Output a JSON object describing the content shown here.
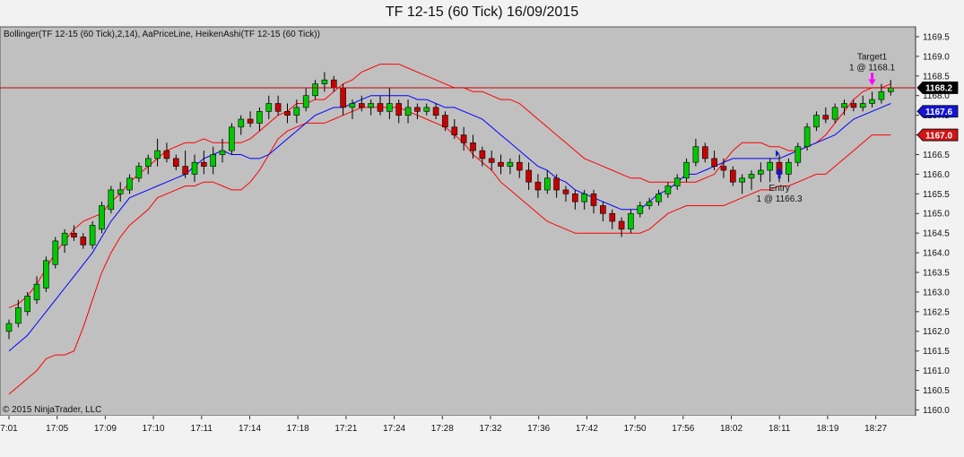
{
  "title": "TF 12-15 (60 Tick)  16/09/2015",
  "indicators": "Bollinger(TF 12-15 (60 Tick),2,14), AaPriceLine, HeikenAshi(TF 12-15 (60 Tick))",
  "copyright": "© 2015 NinjaTrader, LLC",
  "chart_data": {
    "type": "candlestick",
    "ylim": [
      1159.85,
      1169.75
    ],
    "y_ticks": [
      "1160.0",
      "1160.5",
      "1161.0",
      "1161.5",
      "1162.0",
      "1162.5",
      "1163.0",
      "1163.5",
      "1164.0",
      "1164.5",
      "1165.0",
      "1165.5",
      "1166.0",
      "1166.5",
      "1167.0",
      "1167.5",
      "1168.0",
      "1168.5",
      "1169.0",
      "1169.5"
    ],
    "x_ticks": [
      "7:01",
      "17:05",
      "17:09",
      "17:10",
      "17:11",
      "17:14",
      "17:18",
      "17:21",
      "17:24",
      "17:28",
      "17:32",
      "17:36",
      "17:42",
      "17:50",
      "17:56",
      "18:02",
      "18:11",
      "18:19",
      "18:27"
    ],
    "price_line": 1168.2,
    "price_tags": [
      {
        "label": "1168.2",
        "value": 1168.2,
        "bg": "#000000",
        "fg": "#ffffff"
      },
      {
        "label": "1167.6",
        "value": 1167.6,
        "bg": "#1414d2",
        "fg": "#ffffff"
      },
      {
        "label": "1167.0",
        "value": 1167.0,
        "bg": "#d21414",
        "fg": "#ffffff"
      }
    ],
    "bollinger": {
      "upper": [
        1162.6,
        1162.7,
        1162.9,
        1163.2,
        1163.6,
        1164.0,
        1164.3,
        1164.6,
        1164.8,
        1164.9,
        1165.0,
        1165.3,
        1165.5,
        1165.8,
        1166.0,
        1166.2,
        1166.4,
        1166.6,
        1166.7,
        1166.8,
        1166.8,
        1166.9,
        1166.8,
        1166.8,
        1166.8,
        1166.8,
        1166.9,
        1167.1,
        1167.3,
        1167.5,
        1167.6,
        1167.8,
        1167.8,
        1167.9,
        1167.9,
        1168.1,
        1168.3,
        1168.4,
        1168.6,
        1168.7,
        1168.8,
        1168.8,
        1168.8,
        1168.7,
        1168.6,
        1168.5,
        1168.4,
        1168.3,
        1168.2,
        1168.2,
        1168.1,
        1168.1,
        1168.0,
        1167.9,
        1167.9,
        1167.8,
        1167.6,
        1167.4,
        1167.2,
        1167.0,
        1166.8,
        1166.6,
        1166.4,
        1166.3,
        1166.2,
        1166.1,
        1166.0,
        1165.9,
        1165.9,
        1165.8,
        1165.8,
        1165.8,
        1165.8,
        1165.8,
        1165.8,
        1165.9,
        1166.0,
        1166.3,
        1166.6,
        1166.8,
        1166.8,
        1166.8,
        1166.7,
        1166.7,
        1166.6,
        1166.6,
        1166.7,
        1166.8,
        1167.0,
        1167.3,
        1167.6,
        1167.9,
        1168.1,
        1168.2,
        1168.2,
        1168.3
      ],
      "middle": [
        1161.5,
        1161.7,
        1161.9,
        1162.2,
        1162.5,
        1162.8,
        1163.1,
        1163.4,
        1163.7,
        1164.0,
        1164.4,
        1164.8,
        1165.1,
        1165.4,
        1165.5,
        1165.6,
        1165.7,
        1165.8,
        1165.9,
        1166.0,
        1166.2,
        1166.4,
        1166.5,
        1166.6,
        1166.5,
        1166.5,
        1166.4,
        1166.4,
        1166.5,
        1166.7,
        1166.9,
        1167.1,
        1167.3,
        1167.5,
        1167.6,
        1167.7,
        1167.7,
        1167.8,
        1167.9,
        1168.0,
        1168.0,
        1168.0,
        1168.0,
        1168.0,
        1167.9,
        1167.9,
        1167.8,
        1167.7,
        1167.7,
        1167.6,
        1167.5,
        1167.4,
        1167.2,
        1167.0,
        1166.8,
        1166.6,
        1166.4,
        1166.2,
        1166.1,
        1165.9,
        1165.8,
        1165.6,
        1165.5,
        1165.4,
        1165.3,
        1165.2,
        1165.1,
        1165.1,
        1165.1,
        1165.3,
        1165.5,
        1165.6,
        1165.8,
        1166.0,
        1166.0,
        1166.1,
        1166.2,
        1166.3,
        1166.4,
        1166.4,
        1166.4,
        1166.4,
        1166.4,
        1166.4,
        1166.5,
        1166.6,
        1166.7,
        1166.8,
        1166.9,
        1167.0,
        1167.2,
        1167.4,
        1167.5,
        1167.6,
        1167.7,
        1167.8
      ],
      "lower": [
        1160.4,
        1160.6,
        1160.8,
        1161.0,
        1161.3,
        1161.4,
        1161.4,
        1161.5,
        1162.1,
        1162.8,
        1163.5,
        1164.0,
        1164.4,
        1164.7,
        1164.9,
        1165.1,
        1165.4,
        1165.5,
        1165.6,
        1165.7,
        1165.7,
        1165.8,
        1165.8,
        1165.7,
        1165.6,
        1165.6,
        1165.8,
        1166.1,
        1166.5,
        1166.9,
        1167.1,
        1167.2,
        1167.3,
        1167.3,
        1167.3,
        1167.4,
        1167.5,
        1167.6,
        1167.7,
        1167.7,
        1167.7,
        1167.7,
        1167.7,
        1167.6,
        1167.5,
        1167.4,
        1167.3,
        1167.2,
        1167.0,
        1166.8,
        1166.5,
        1166.3,
        1166.1,
        1165.8,
        1165.6,
        1165.4,
        1165.2,
        1165.0,
        1164.8,
        1164.7,
        1164.6,
        1164.5,
        1164.5,
        1164.5,
        1164.5,
        1164.5,
        1164.5,
        1164.5,
        1164.5,
        1164.6,
        1164.8,
        1165.0,
        1165.1,
        1165.2,
        1165.2,
        1165.2,
        1165.2,
        1165.2,
        1165.3,
        1165.4,
        1165.5,
        1165.6,
        1165.6,
        1165.7,
        1165.7,
        1165.8,
        1165.9,
        1166.0,
        1166.0,
        1166.2,
        1166.4,
        1166.6,
        1166.8,
        1167.0,
        1167.0,
        1167.0
      ]
    },
    "candles": [
      {
        "o": 1162.0,
        "h": 1162.3,
        "l": 1161.8,
        "c": 1162.2
      },
      {
        "o": 1162.2,
        "h": 1162.8,
        "l": 1162.1,
        "c": 1162.6
      },
      {
        "o": 1162.5,
        "h": 1163.0,
        "l": 1162.4,
        "c": 1162.9
      },
      {
        "o": 1162.8,
        "h": 1163.4,
        "l": 1162.7,
        "c": 1163.2
      },
      {
        "o": 1163.1,
        "h": 1163.9,
        "l": 1163.0,
        "c": 1163.8
      },
      {
        "o": 1163.7,
        "h": 1164.4,
        "l": 1163.6,
        "c": 1164.3
      },
      {
        "o": 1164.2,
        "h": 1164.6,
        "l": 1164.0,
        "c": 1164.5
      },
      {
        "o": 1164.5,
        "h": 1164.7,
        "l": 1164.3,
        "c": 1164.4
      },
      {
        "o": 1164.4,
        "h": 1164.5,
        "l": 1164.1,
        "c": 1164.2
      },
      {
        "o": 1164.2,
        "h": 1164.8,
        "l": 1164.1,
        "c": 1164.7
      },
      {
        "o": 1164.6,
        "h": 1165.3,
        "l": 1164.5,
        "c": 1165.2
      },
      {
        "o": 1165.1,
        "h": 1165.7,
        "l": 1165.0,
        "c": 1165.6
      },
      {
        "o": 1165.5,
        "h": 1165.8,
        "l": 1165.3,
        "c": 1165.6
      },
      {
        "o": 1165.6,
        "h": 1166.0,
        "l": 1165.5,
        "c": 1165.9
      },
      {
        "o": 1165.9,
        "h": 1166.3,
        "l": 1165.8,
        "c": 1166.2
      },
      {
        "o": 1166.2,
        "h": 1166.5,
        "l": 1166.0,
        "c": 1166.4
      },
      {
        "o": 1166.4,
        "h": 1166.9,
        "l": 1166.2,
        "c": 1166.6
      },
      {
        "o": 1166.6,
        "h": 1166.8,
        "l": 1166.3,
        "c": 1166.4
      },
      {
        "o": 1166.4,
        "h": 1166.5,
        "l": 1166.1,
        "c": 1166.2
      },
      {
        "o": 1166.2,
        "h": 1166.6,
        "l": 1165.9,
        "c": 1166.0
      },
      {
        "o": 1166.0,
        "h": 1166.5,
        "l": 1165.8,
        "c": 1166.3
      },
      {
        "o": 1166.3,
        "h": 1166.6,
        "l": 1166.0,
        "c": 1166.2
      },
      {
        "o": 1166.2,
        "h": 1166.7,
        "l": 1166.0,
        "c": 1166.5
      },
      {
        "o": 1166.5,
        "h": 1166.9,
        "l": 1166.3,
        "c": 1166.6
      },
      {
        "o": 1166.6,
        "h": 1167.3,
        "l": 1166.5,
        "c": 1167.2
      },
      {
        "o": 1167.2,
        "h": 1167.5,
        "l": 1167.0,
        "c": 1167.4
      },
      {
        "o": 1167.4,
        "h": 1167.6,
        "l": 1167.2,
        "c": 1167.3
      },
      {
        "o": 1167.3,
        "h": 1167.7,
        "l": 1167.1,
        "c": 1167.6
      },
      {
        "o": 1167.6,
        "h": 1168.0,
        "l": 1167.4,
        "c": 1167.8
      },
      {
        "o": 1167.8,
        "h": 1168.0,
        "l": 1167.5,
        "c": 1167.6
      },
      {
        "o": 1167.6,
        "h": 1167.8,
        "l": 1167.3,
        "c": 1167.5
      },
      {
        "o": 1167.5,
        "h": 1167.9,
        "l": 1167.3,
        "c": 1167.7
      },
      {
        "o": 1167.7,
        "h": 1168.2,
        "l": 1167.6,
        "c": 1168.0
      },
      {
        "o": 1168.0,
        "h": 1168.4,
        "l": 1167.9,
        "c": 1168.3
      },
      {
        "o": 1168.3,
        "h": 1168.6,
        "l": 1168.1,
        "c": 1168.4
      },
      {
        "o": 1168.4,
        "h": 1168.5,
        "l": 1168.1,
        "c": 1168.2
      },
      {
        "o": 1168.2,
        "h": 1168.3,
        "l": 1167.5,
        "c": 1167.7
      },
      {
        "o": 1167.7,
        "h": 1167.9,
        "l": 1167.4,
        "c": 1167.8
      },
      {
        "o": 1167.8,
        "h": 1168.0,
        "l": 1167.6,
        "c": 1167.7
      },
      {
        "o": 1167.7,
        "h": 1167.9,
        "l": 1167.5,
        "c": 1167.8
      },
      {
        "o": 1167.8,
        "h": 1168.0,
        "l": 1167.5,
        "c": 1167.6
      },
      {
        "o": 1167.6,
        "h": 1168.2,
        "l": 1167.4,
        "c": 1167.8
      },
      {
        "o": 1167.8,
        "h": 1167.9,
        "l": 1167.3,
        "c": 1167.5
      },
      {
        "o": 1167.5,
        "h": 1167.9,
        "l": 1167.3,
        "c": 1167.7
      },
      {
        "o": 1167.7,
        "h": 1167.8,
        "l": 1167.4,
        "c": 1167.6
      },
      {
        "o": 1167.6,
        "h": 1167.8,
        "l": 1167.5,
        "c": 1167.7
      },
      {
        "o": 1167.7,
        "h": 1167.8,
        "l": 1167.4,
        "c": 1167.5
      },
      {
        "o": 1167.5,
        "h": 1167.6,
        "l": 1167.1,
        "c": 1167.2
      },
      {
        "o": 1167.2,
        "h": 1167.4,
        "l": 1166.9,
        "c": 1167.0
      },
      {
        "o": 1167.0,
        "h": 1167.2,
        "l": 1166.6,
        "c": 1166.8
      },
      {
        "o": 1166.8,
        "h": 1167.0,
        "l": 1166.4,
        "c": 1166.6
      },
      {
        "o": 1166.6,
        "h": 1166.7,
        "l": 1166.2,
        "c": 1166.4
      },
      {
        "o": 1166.4,
        "h": 1166.6,
        "l": 1166.1,
        "c": 1166.3
      },
      {
        "o": 1166.3,
        "h": 1166.5,
        "l": 1166.0,
        "c": 1166.2
      },
      {
        "o": 1166.2,
        "h": 1166.4,
        "l": 1166.0,
        "c": 1166.3
      },
      {
        "o": 1166.3,
        "h": 1166.5,
        "l": 1165.9,
        "c": 1166.1
      },
      {
        "o": 1166.1,
        "h": 1166.3,
        "l": 1165.6,
        "c": 1165.8
      },
      {
        "o": 1165.8,
        "h": 1166.0,
        "l": 1165.4,
        "c": 1165.6
      },
      {
        "o": 1165.6,
        "h": 1166.1,
        "l": 1165.5,
        "c": 1165.9
      },
      {
        "o": 1165.9,
        "h": 1166.0,
        "l": 1165.4,
        "c": 1165.6
      },
      {
        "o": 1165.6,
        "h": 1165.7,
        "l": 1165.3,
        "c": 1165.5
      },
      {
        "o": 1165.5,
        "h": 1165.6,
        "l": 1165.1,
        "c": 1165.3
      },
      {
        "o": 1165.3,
        "h": 1165.6,
        "l": 1165.1,
        "c": 1165.5
      },
      {
        "o": 1165.5,
        "h": 1165.6,
        "l": 1165.0,
        "c": 1165.2
      },
      {
        "o": 1165.2,
        "h": 1165.3,
        "l": 1164.8,
        "c": 1165.0
      },
      {
        "o": 1165.0,
        "h": 1165.1,
        "l": 1164.6,
        "c": 1164.8
      },
      {
        "o": 1164.8,
        "h": 1164.9,
        "l": 1164.4,
        "c": 1164.6
      },
      {
        "o": 1164.6,
        "h": 1165.1,
        "l": 1164.5,
        "c": 1165.0
      },
      {
        "o": 1165.0,
        "h": 1165.3,
        "l": 1164.9,
        "c": 1165.2
      },
      {
        "o": 1165.2,
        "h": 1165.4,
        "l": 1165.1,
        "c": 1165.3
      },
      {
        "o": 1165.3,
        "h": 1165.6,
        "l": 1165.2,
        "c": 1165.5
      },
      {
        "o": 1165.5,
        "h": 1165.8,
        "l": 1165.4,
        "c": 1165.7
      },
      {
        "o": 1165.7,
        "h": 1166.0,
        "l": 1165.6,
        "c": 1165.9
      },
      {
        "o": 1165.9,
        "h": 1166.4,
        "l": 1165.8,
        "c": 1166.3
      },
      {
        "o": 1166.3,
        "h": 1166.9,
        "l": 1166.2,
        "c": 1166.7
      },
      {
        "o": 1166.7,
        "h": 1166.8,
        "l": 1166.3,
        "c": 1166.4
      },
      {
        "o": 1166.4,
        "h": 1166.6,
        "l": 1166.1,
        "c": 1166.2
      },
      {
        "o": 1166.2,
        "h": 1166.4,
        "l": 1165.9,
        "c": 1166.1
      },
      {
        "o": 1166.1,
        "h": 1166.2,
        "l": 1165.7,
        "c": 1165.8
      },
      {
        "o": 1165.8,
        "h": 1166.0,
        "l": 1165.5,
        "c": 1165.9
      },
      {
        "o": 1165.9,
        "h": 1166.1,
        "l": 1165.6,
        "c": 1166.0
      },
      {
        "o": 1166.0,
        "h": 1166.3,
        "l": 1165.8,
        "c": 1166.1
      },
      {
        "o": 1166.1,
        "h": 1166.4,
        "l": 1165.8,
        "c": 1166.3
      },
      {
        "o": 1166.3,
        "h": 1166.5,
        "l": 1165.8,
        "c": 1166.0
      },
      {
        "o": 1166.0,
        "h": 1166.4,
        "l": 1165.8,
        "c": 1166.3
      },
      {
        "o": 1166.3,
        "h": 1166.8,
        "l": 1166.2,
        "c": 1166.7
      },
      {
        "o": 1166.7,
        "h": 1167.3,
        "l": 1166.6,
        "c": 1167.2
      },
      {
        "o": 1167.2,
        "h": 1167.6,
        "l": 1167.1,
        "c": 1167.5
      },
      {
        "o": 1167.5,
        "h": 1167.7,
        "l": 1167.3,
        "c": 1167.4
      },
      {
        "o": 1167.4,
        "h": 1167.8,
        "l": 1167.3,
        "c": 1167.7
      },
      {
        "o": 1167.7,
        "h": 1167.9,
        "l": 1167.5,
        "c": 1167.8
      },
      {
        "o": 1167.8,
        "h": 1167.9,
        "l": 1167.6,
        "c": 1167.7
      },
      {
        "o": 1167.7,
        "h": 1168.0,
        "l": 1167.6,
        "c": 1167.8
      },
      {
        "o": 1167.8,
        "h": 1168.1,
        "l": 1167.7,
        "c": 1167.9
      },
      {
        "o": 1167.9,
        "h": 1168.3,
        "l": 1167.8,
        "c": 1168.1
      },
      {
        "o": 1168.1,
        "h": 1168.4,
        "l": 1168.0,
        "c": 1168.2
      }
    ],
    "annotations": [
      {
        "id": "entry",
        "line1": "Entry",
        "line2": "1 @ 1166.3",
        "bar": 83,
        "price": 1166.3
      },
      {
        "id": "target",
        "line1": "Target1",
        "line2": "1 @ 1168.1",
        "bar": 93,
        "price": 1168.1
      }
    ],
    "colors": {
      "background": "#c0c0c0",
      "up": "#00c800",
      "down": "#c80000",
      "band": "#ff0000",
      "mid": "#0000ff",
      "price_line": "#c80000",
      "entry_arrow": "#1414d2",
      "target_arrow": "#ff00ff"
    }
  }
}
